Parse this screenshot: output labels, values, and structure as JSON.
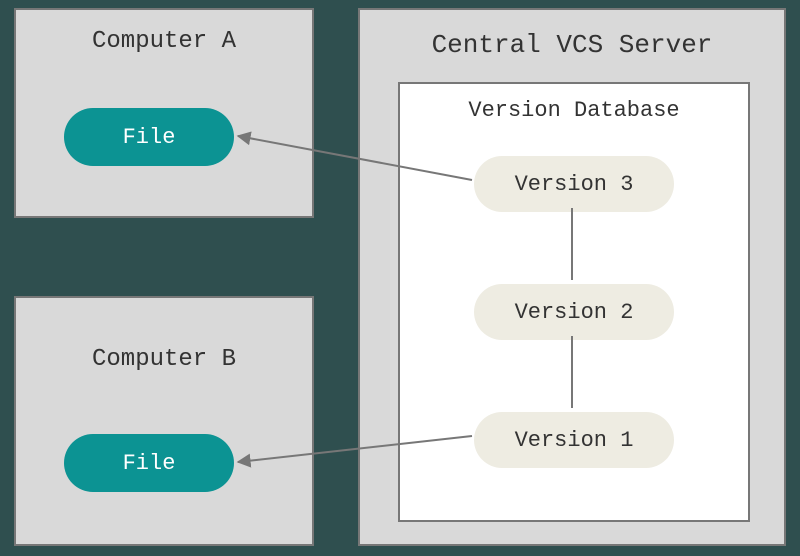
{
  "computerA": {
    "title": "Computer A",
    "file_label": "File"
  },
  "computerB": {
    "title": "Computer B",
    "file_label": "File"
  },
  "server": {
    "title": "Central VCS Server",
    "database": {
      "title": "Version Database",
      "versions": [
        "Version 3",
        "Version 2",
        "Version 1"
      ]
    }
  },
  "diagram": {
    "description": "Centralized Version Control System architecture. Two client computers (A and B) each hold a File checked out from a central VCS server containing a Version Database with Versions 1, 2, 3.",
    "connections": [
      {
        "from": "server.database.versions.0",
        "to": "computerA.file"
      },
      {
        "from": "server.database.versions.2",
        "to": "computerB.file"
      },
      {
        "from": "server.database.versions.0",
        "to": "server.database.versions.1",
        "kind": "link"
      },
      {
        "from": "server.database.versions.1",
        "to": "server.database.versions.2",
        "kind": "link"
      }
    ]
  },
  "colors": {
    "background": "#2f4f4f",
    "panel": "#d9d9d9",
    "file_pill": "#0c9393",
    "version_pill": "#eeece2",
    "border": "#777777"
  }
}
